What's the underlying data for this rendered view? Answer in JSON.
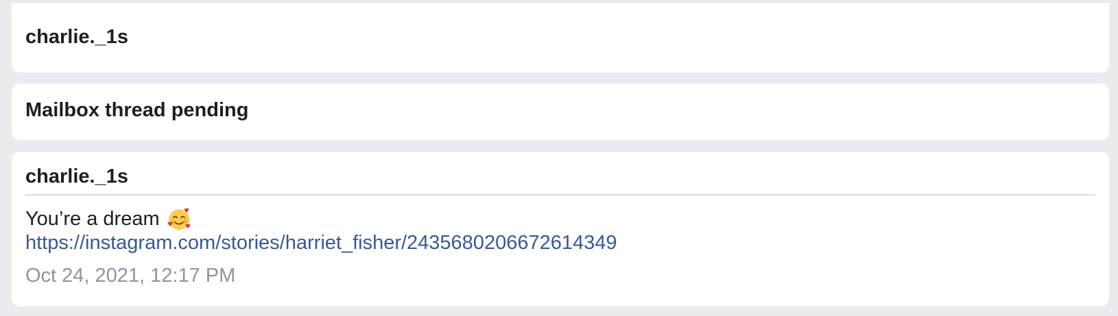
{
  "thread": {
    "first_message": {
      "sender": "charlie._1s"
    },
    "status_text": "Mailbox thread pending",
    "last_message": {
      "sender": "charlie._1s",
      "text": "You’re a dream",
      "emoji_icon": "smiling-face-with-hearts-icon",
      "link": "https://instagram.com/stories/harriet_fisher/2435680206672614349",
      "timestamp": "Oct 24, 2021, 12:17 PM"
    }
  },
  "colors": {
    "page_background": "#e9ebee",
    "card_background": "#ffffff",
    "link": "#385898",
    "timestamp": "#90949c",
    "text": "#1c1e21"
  }
}
